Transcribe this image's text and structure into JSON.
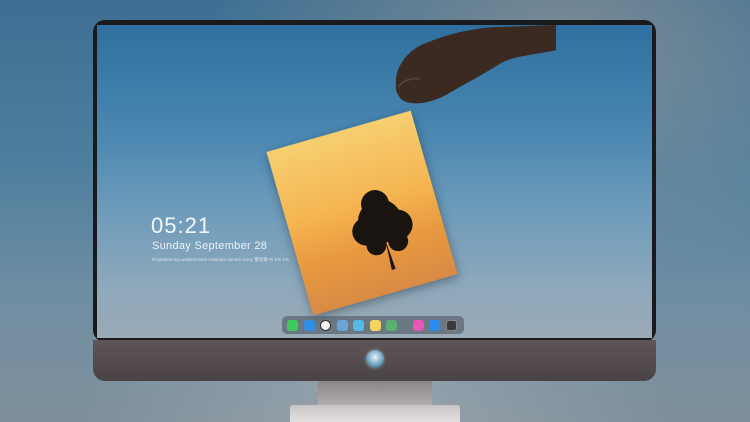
{
  "lock_screen": {
    "time": "05:21",
    "date": "Sunday September  28",
    "note": "Rosantenning waitiest teem rreweam aanedi vorny 量如做 Ri 1% 1%"
  },
  "dock": {
    "apps": [
      {
        "name": "messages-icon",
        "color": "#3ec95a"
      },
      {
        "name": "finder-icon",
        "color": "#2f8de4"
      },
      {
        "name": "clock-icon",
        "color": "#f2f2f2"
      },
      {
        "name": "preview-icon",
        "color": "#6aa3d8"
      },
      {
        "name": "clapper-icon",
        "color": "#58b8e8"
      },
      {
        "name": "notes-icon",
        "color": "#f6d35a"
      },
      {
        "name": "photos-icon",
        "color": "#5ab06f"
      },
      {
        "name": "music-icon",
        "color": "#e857b7"
      },
      {
        "name": "app-store-icon",
        "color": "#2a8cf0"
      },
      {
        "name": "camera-icon",
        "color": "#3a3a3c"
      }
    ]
  },
  "colors": {
    "frame": "#1a1a1c",
    "chin": "#564e51",
    "sky_top": "#2f6f9f",
    "photo_warm": "#f5b451"
  }
}
